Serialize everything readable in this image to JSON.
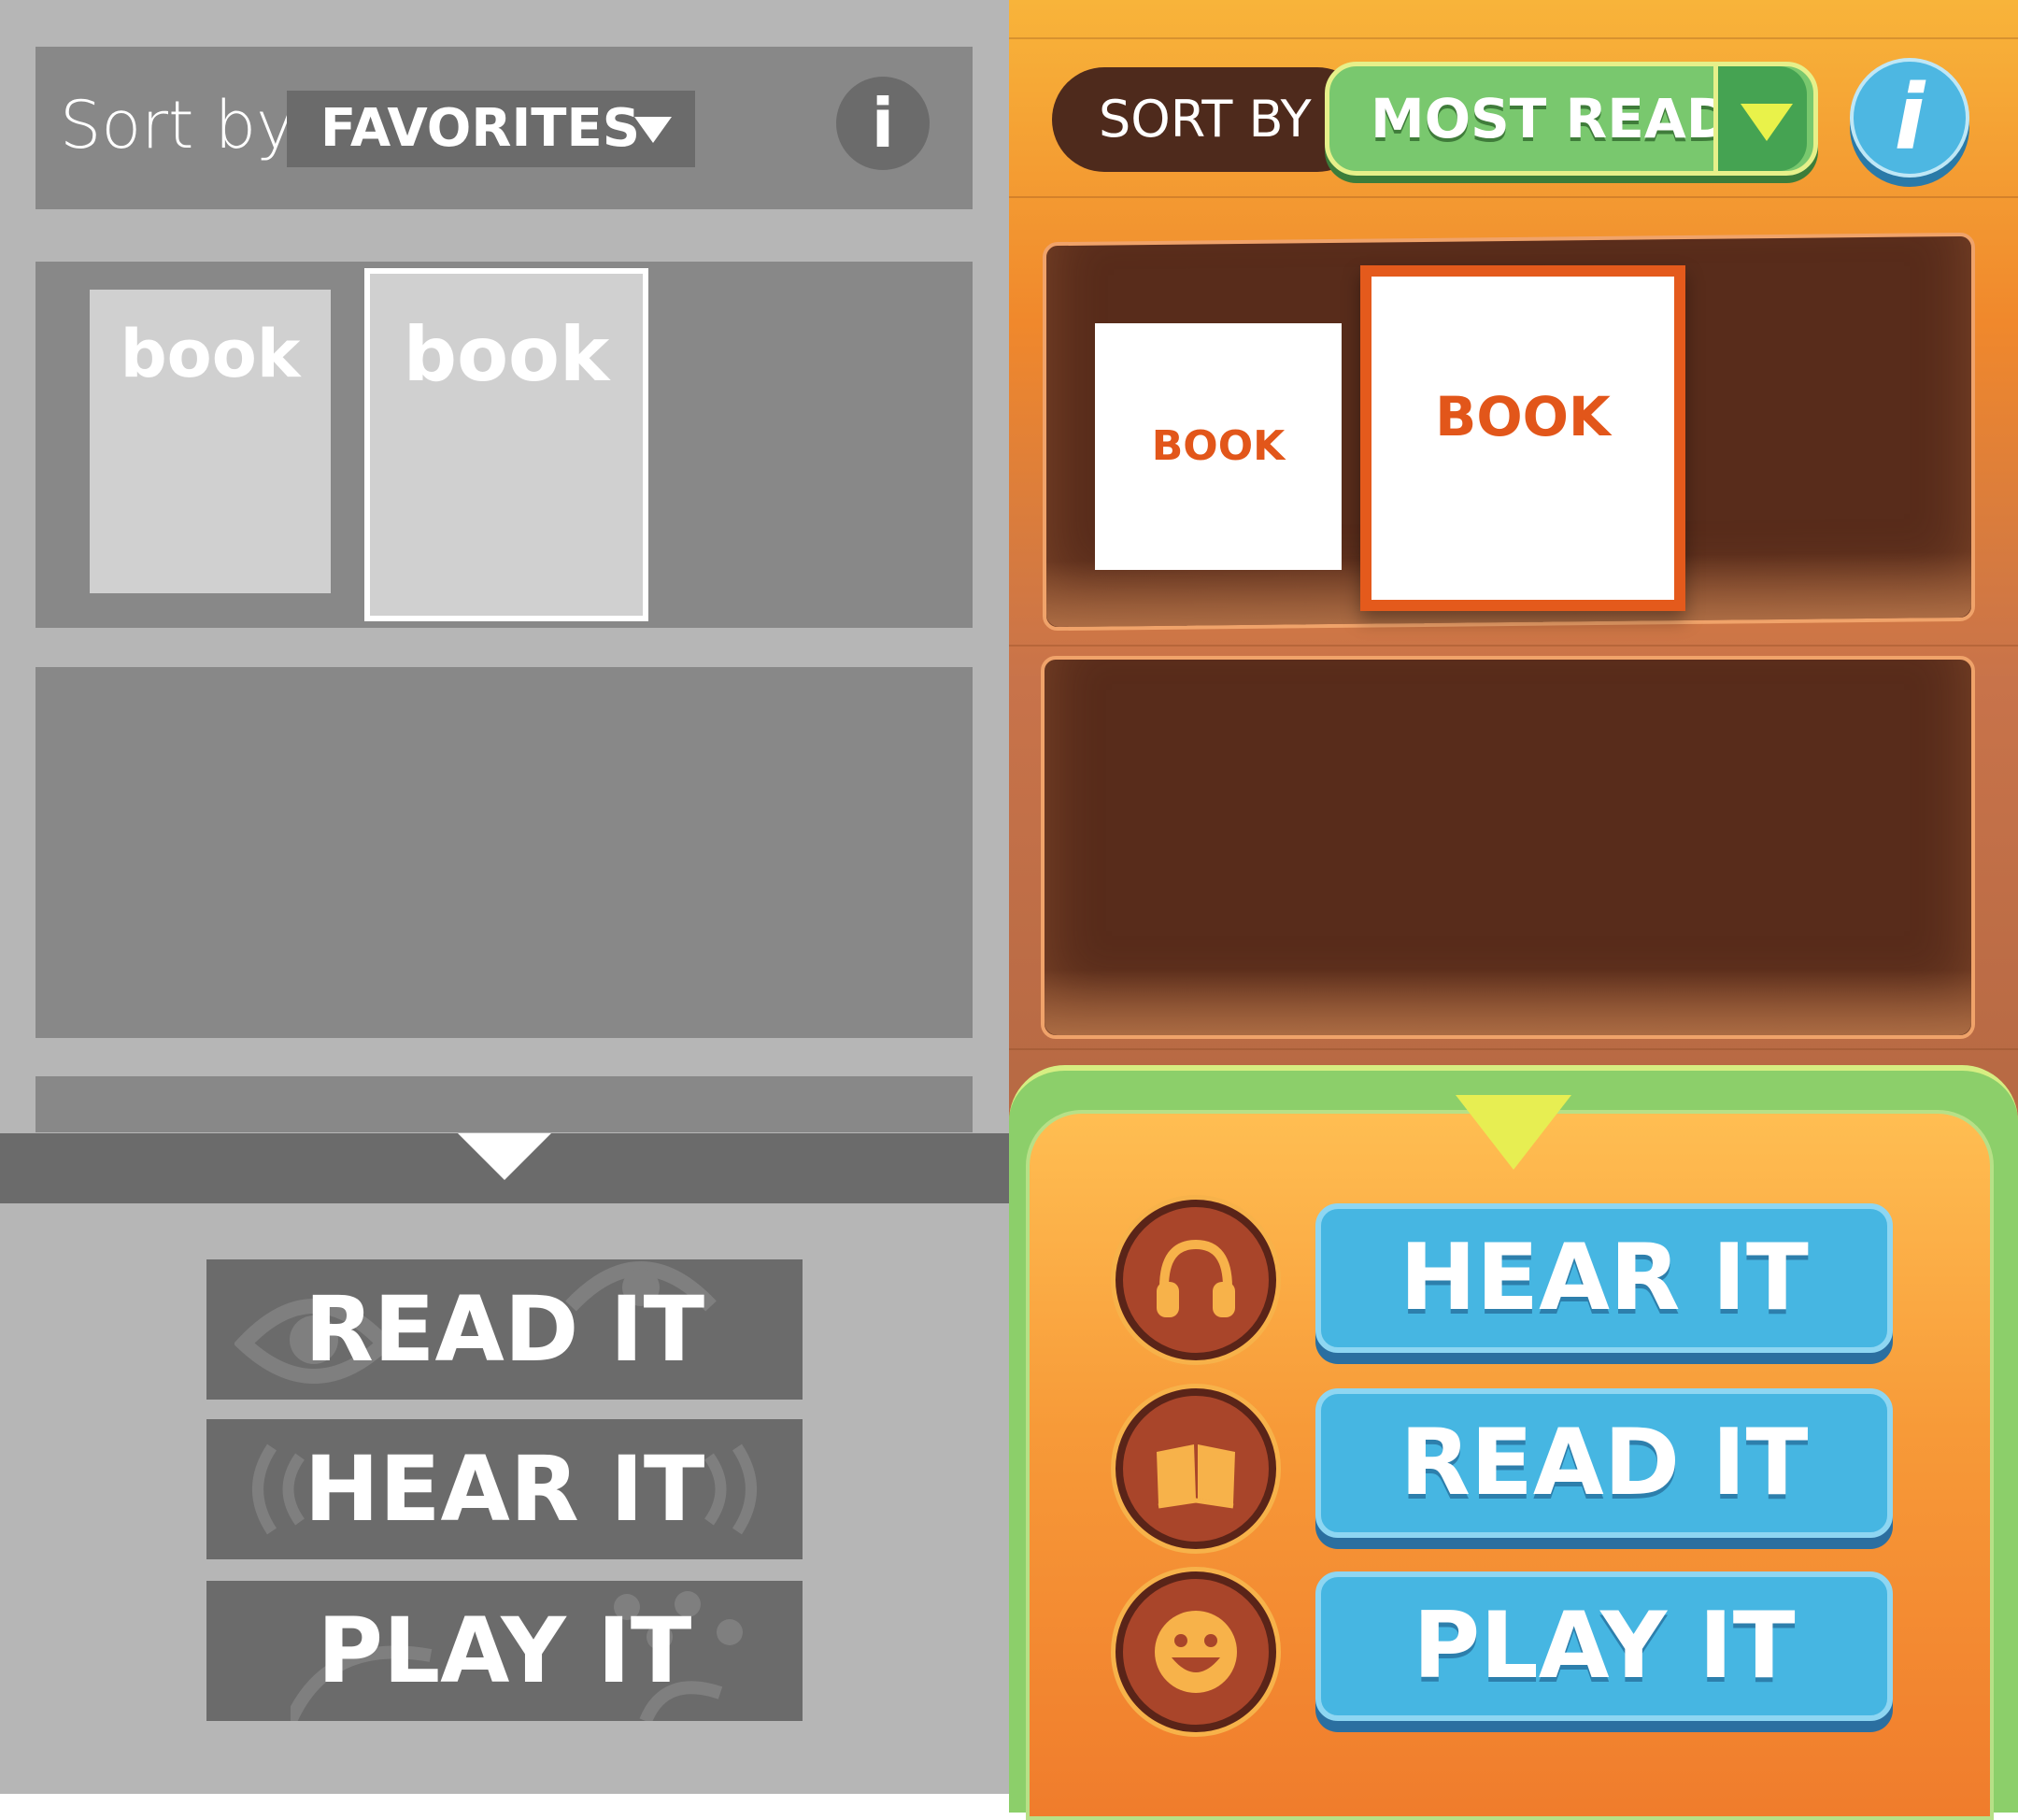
{
  "wireframe": {
    "sort_label": "Sort by",
    "sort_value": "FAVORITES",
    "info_label": "i",
    "books": [
      "book",
      "book"
    ],
    "actions": [
      "READ IT",
      "HEAR IT",
      "PLAY IT"
    ]
  },
  "game": {
    "sort_label": "SORT BY",
    "sort_value": "MOST READ",
    "info_label": "i",
    "books": [
      "BOOK",
      "BOOK"
    ],
    "actions": [
      "HEAR IT",
      "READ IT",
      "PLAY IT"
    ],
    "action_icons": [
      "headphones-icon",
      "book-icon",
      "smiley-icon"
    ],
    "colors": {
      "accent_orange": "#e2561a",
      "button_blue": "#46b6e2",
      "dropdown_green": "#79c86e",
      "shelf_brown": "#582c1b"
    }
  }
}
